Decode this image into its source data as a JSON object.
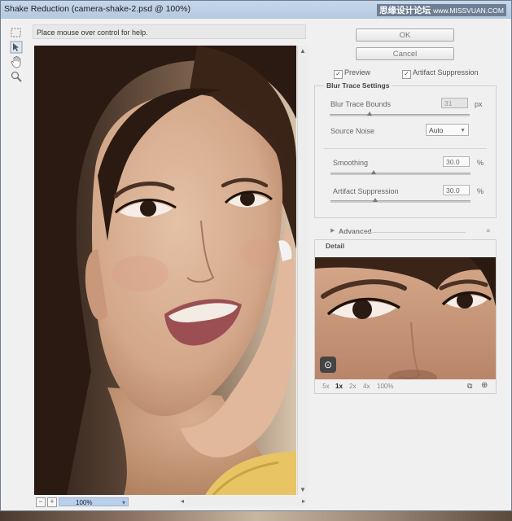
{
  "window": {
    "title": "Shake Reduction (camera-shake-2.psd @ 100%)",
    "watermark": "思缘设计论坛",
    "watermark_url": "www.MISSVUAN.COM"
  },
  "help_text": "Place mouse over control for help.",
  "tools": [
    "marquee-icon",
    "blur-estimation-icon",
    "hand-icon",
    "zoom-icon"
  ],
  "buttons": {
    "ok": "OK",
    "cancel": "Cancel"
  },
  "checks": {
    "preview": "Preview",
    "artifact": "Artifact Suppression"
  },
  "blur_trace": {
    "title": "Blur Trace Settings",
    "bounds_label": "Blur Trace Bounds",
    "bounds_value": "31",
    "bounds_unit": "px",
    "noise_label": "Source Noise",
    "noise_value": "Auto",
    "smoothing_label": "Smoothing",
    "smoothing_value": "30.0",
    "smoothing_unit": "%",
    "artifact_label": "Artifact Suppression",
    "artifact_value": "30.0",
    "artifact_unit": "%"
  },
  "advanced_label": "Advanced",
  "detail": {
    "title": "Detail",
    "zoom_levels": [
      ".5x",
      "1x",
      "2x",
      "4x",
      "100%"
    ],
    "active_zoom": "1x"
  },
  "zoom": {
    "value": "100%",
    "minus": "−",
    "plus": "+"
  },
  "colors": {
    "accent": "#b9d0ec",
    "titlebar": "#b4c8e0"
  }
}
